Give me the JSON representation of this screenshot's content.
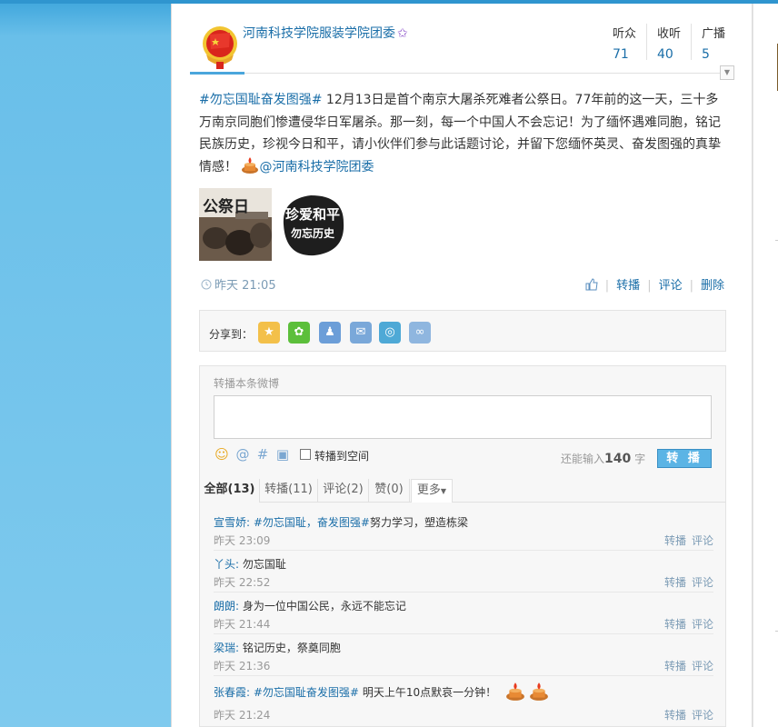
{
  "user": {
    "name": "河南科技学院服装学院团委"
  },
  "stats": [
    {
      "label": "听众",
      "value": "71"
    },
    {
      "label": "收听",
      "value": "40"
    },
    {
      "label": "广播",
      "value": "5"
    }
  ],
  "post": {
    "tag": "#勿忘国耻奋发图强#",
    "text": " 12月13日是首个南京大屠杀死难者公祭日。77年前的这一天，三十多万南京同胞们惨遭侵华日军屠杀。那一刻，每一个中国人不会忘记！为了缅怀遇难同胞，铭记民族历史，珍视今日和平，请小伙伴们参与此话题讨论，并留下您缅怀英灵、奋发图强的真挚情感！",
    "mention": "@河南科技学院团委",
    "time": "昨天 21:05",
    "image1_title": "公祭日",
    "image2_line1": "珍爱和平",
    "image2_line2": "勿忘历史"
  },
  "actions": {
    "forward": "转播",
    "comment": "评论",
    "delete": "删除"
  },
  "share": {
    "label": "分享到："
  },
  "forward_box": {
    "title": "转播本条微博",
    "checkbox_label": "转播到空间",
    "remain_prefix": "还能输入",
    "remain_count": "140",
    "remain_suffix": "字",
    "button": "转 播"
  },
  "filters": [
    {
      "label": "全部(13)"
    },
    {
      "label": "转播(11)"
    },
    {
      "label": "评论(2)"
    },
    {
      "label": "赞(0)"
    },
    {
      "label": "更多"
    }
  ],
  "row_actions": {
    "forward": "转播",
    "comment": "评论"
  },
  "comments": [
    {
      "author": "宣雪娇:",
      "tag": "#勿忘国耻，奋发图强#",
      "text": "努力学习，塑造栋梁",
      "time": "昨天 23:09"
    },
    {
      "author": "丫头:",
      "tag": "",
      "text": " 勿忘国耻",
      "time": "昨天 22:52"
    },
    {
      "author": "朗朗:",
      "tag": "",
      "text": " 身为一位中国公民，永远不能忘记",
      "time": "昨天 21:44"
    },
    {
      "author": "梁瑞:",
      "tag": "",
      "text": " 铭记历史，祭奠同胞",
      "time": "昨天 21:36"
    },
    {
      "author": "张春霞:",
      "tag": "#勿忘国耻奋发图强#",
      "text": " 明天上午10点默哀一分钟！",
      "time": "昨天 21:24"
    }
  ]
}
